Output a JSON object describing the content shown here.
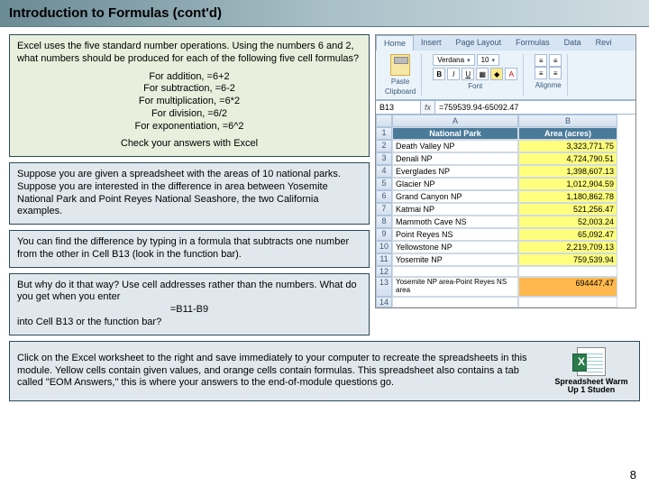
{
  "title": "Introduction to Formulas (cont'd)",
  "box1": {
    "intro": "Excel uses the five standard number operations.  Using the numbers 6 and 2, what numbers should be produced for each of the following five cell formulas?",
    "formulas": [
      "For addition, =6+2",
      "For subtraction, =6-2",
      "For multiplication, =6*2",
      "For division, =6/2",
      "For exponentiation, =6^2"
    ],
    "check": "Check your answers with Excel"
  },
  "box2": "Suppose you are given a spreadsheet with the areas of 10 national parks.  Suppose you are interested in the difference in area between Yosemite National Park and Point Reyes National Seashore, the two California examples.",
  "box3": "You can find the difference by typing in a formula that subtracts one number from the other in Cell B13 (look in the function bar).",
  "box4": {
    "l1": "But why do it that way?  Use cell addresses rather than the numbers.  What do you get when you enter",
    "l2": "=B11-B9",
    "l3": "into Cell B13 or the function bar?"
  },
  "excel": {
    "tabs": [
      "Home",
      "Insert",
      "Page Layout",
      "Formulas",
      "Data",
      "Revi"
    ],
    "paste": "Paste",
    "clipboard": "Clipboard",
    "font_name": "Verdana",
    "font_size": "10",
    "font_group": "Font",
    "align_group": "Alignme",
    "nameBox": "B13",
    "formula": "=759539.94-65092.47",
    "cols": [
      "",
      "A",
      "B"
    ],
    "headers": [
      "National Park",
      "Area (acres)"
    ],
    "rows": [
      {
        "n": "1"
      },
      {
        "n": "2",
        "a": "Death Valley NP",
        "b": "3,323,771.75"
      },
      {
        "n": "3",
        "a": "Denali NP",
        "b": "4,724,790.51"
      },
      {
        "n": "4",
        "a": "Everglades NP",
        "b": "1,398,607.13"
      },
      {
        "n": "5",
        "a": "Glacier NP",
        "b": "1,012,904.59"
      },
      {
        "n": "6",
        "a": "Grand Canyon NP",
        "b": "1,180,862.78"
      },
      {
        "n": "7",
        "a": "Katmai NP",
        "b": "521,256.47"
      },
      {
        "n": "8",
        "a": "Mammoth Cave NS",
        "b": "52,003.24"
      },
      {
        "n": "9",
        "a": "Point Reyes NS",
        "b": "65,092.47"
      },
      {
        "n": "10",
        "a": "Yellowstone NP",
        "b": "2,219,709.13"
      },
      {
        "n": "11",
        "a": "Yosemite NP",
        "b": "759,539.94"
      },
      {
        "n": "12",
        "a": "",
        "b": ""
      },
      {
        "n": "13",
        "a": "Yosemite NP area-Point Reyes NS area",
        "b": "694447.47",
        "a2": true
      },
      {
        "n": "14",
        "a": "",
        "b": ""
      }
    ]
  },
  "bottom": "Click on the Excel worksheet to the right and save immediately to your computer to recreate the spreadsheets in this module. Yellow cells contain given values, and orange cells contain formulas.  This spreadsheet also contains a tab called \"EOM Answers,\" this is where your answers to the end-of-module questions go.",
  "file_label": "Spreadsheet Warm Up 1 Studen",
  "page": "8"
}
